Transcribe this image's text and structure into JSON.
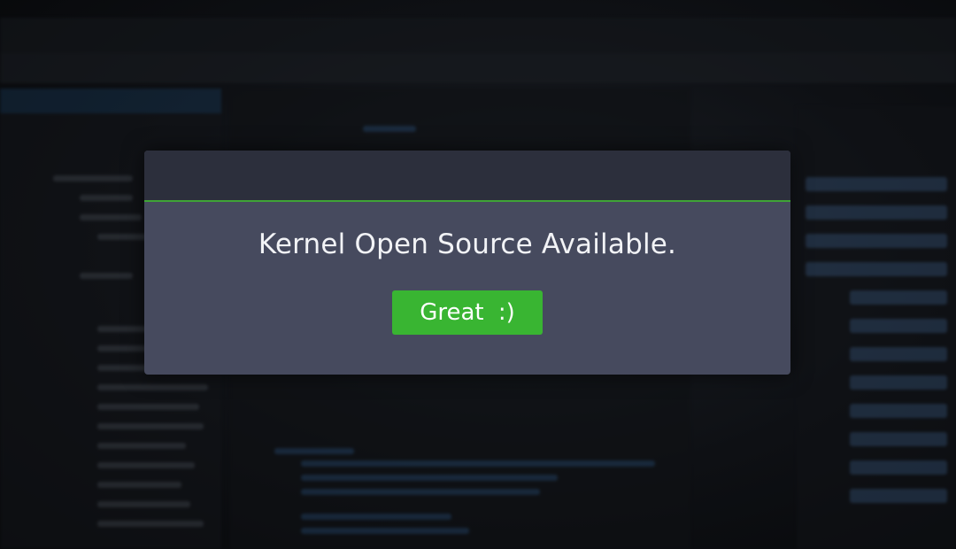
{
  "dialog": {
    "message": "Kernel Open Source Available.",
    "button_label": "Great  :)"
  },
  "colors": {
    "dialog_background": "#464a5e",
    "dialog_header": "#2c2f3c",
    "accent_line": "#3fa436",
    "button": "#39b532",
    "text": "#f2f3f6"
  }
}
